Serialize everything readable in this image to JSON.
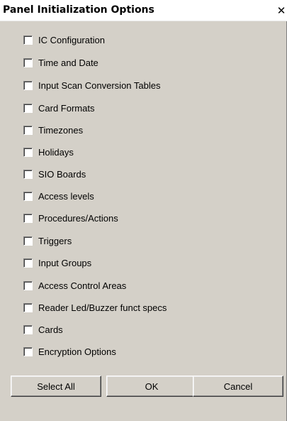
{
  "window": {
    "title": "Panel Initialization Options",
    "close_glyph": "✕"
  },
  "options": [
    {
      "label": "IC Configuration",
      "checked": false
    },
    {
      "label": "Time and Date",
      "checked": false
    },
    {
      "label": "Input Scan Conversion Tables",
      "checked": false
    },
    {
      "label": "Card Formats",
      "checked": false
    },
    {
      "label": "Timezones",
      "checked": false
    },
    {
      "label": "Holidays",
      "checked": false
    },
    {
      "label": "SIO Boards",
      "checked": false
    },
    {
      "label": "Access levels",
      "checked": false
    },
    {
      "label": "Procedures/Actions",
      "checked": false
    },
    {
      "label": "Triggers",
      "checked": false
    },
    {
      "label": "Input Groups",
      "checked": false
    },
    {
      "label": "Access Control Areas",
      "checked": false
    },
    {
      "label": "Reader Led/Buzzer funct specs",
      "checked": false
    },
    {
      "label": "Cards",
      "checked": false
    },
    {
      "label": "Encryption Options",
      "checked": false
    }
  ],
  "buttons": {
    "select_all": "Select All",
    "ok": "OK",
    "cancel": "Cancel"
  },
  "colors": {
    "dialog_background": "#d4d0c8",
    "title_background": "#ffffff",
    "checkbox_fill": "#ffffff"
  }
}
